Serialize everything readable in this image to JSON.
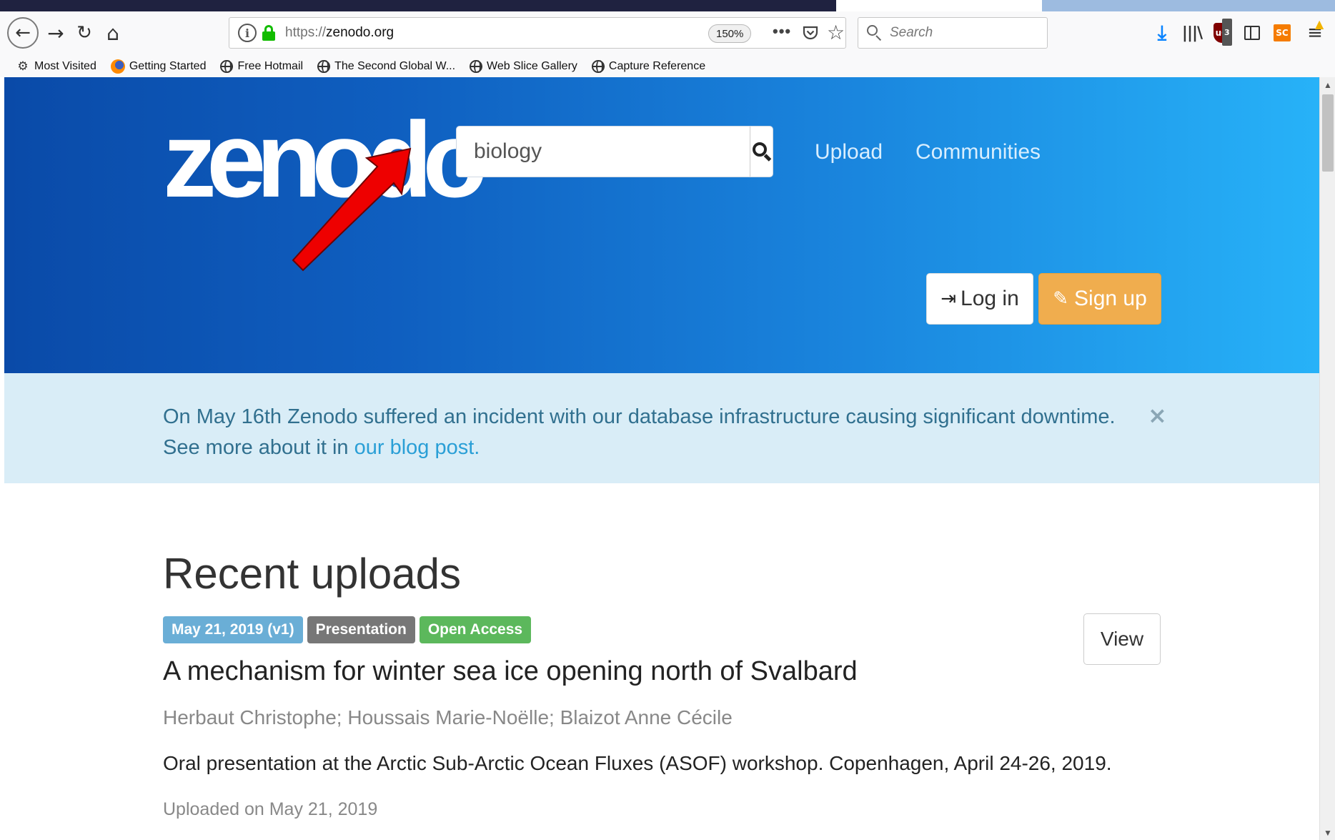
{
  "browser": {
    "url_protocol": "https://",
    "url_host": "zenodo.org",
    "zoom": "150%",
    "more": "•••",
    "search_placeholder": "Search",
    "ublock_count": "3",
    "sc_label": "SC",
    "bookmarks": [
      {
        "label": "Most Visited",
        "icon": "gear-icon"
      },
      {
        "label": "Getting Started",
        "icon": "firefox-icon"
      },
      {
        "label": "Free Hotmail",
        "icon": "globe-icon"
      },
      {
        "label": "The Second Global W...",
        "icon": "globe-icon"
      },
      {
        "label": "Web Slice Gallery",
        "icon": "globe-icon"
      },
      {
        "label": "Capture Reference",
        "icon": "globe-icon"
      }
    ]
  },
  "header": {
    "logo": "zenodo",
    "search_value": "biology",
    "nav": [
      "Upload",
      "Communities"
    ],
    "login_label": "Log in",
    "signup_label": "Sign up"
  },
  "alert": {
    "text": "On May 16th Zenodo suffered an incident with our database infrastructure causing significant downtime. See more about it in ",
    "link_text": "our blog post.",
    "close": "×"
  },
  "recent": {
    "heading": "Recent uploads",
    "records": [
      {
        "date_badge": "May 21, 2019 (v1)",
        "type_badge": "Presentation",
        "access_badge": "Open Access",
        "view_label": "View",
        "title": "A mechanism for winter sea ice opening north of Svalbard",
        "authors": "Herbaut Christophe; Houssais Marie-Noëlle; Blaizot Anne Cécile",
        "description": "Oral presentation at the Arctic Sub-Arctic Ocean Fluxes (ASOF) workshop. Copenhagen, April 24-26, 2019.",
        "uploaded": "Uploaded on May 21, 2019"
      }
    ]
  },
  "colors": {
    "hero_start": "#0a4aa8",
    "hero_end": "#27b2f8",
    "signup": "#f0ad4e",
    "alert_bg": "#d9edf7",
    "annotation_arrow": "#ee0000"
  }
}
